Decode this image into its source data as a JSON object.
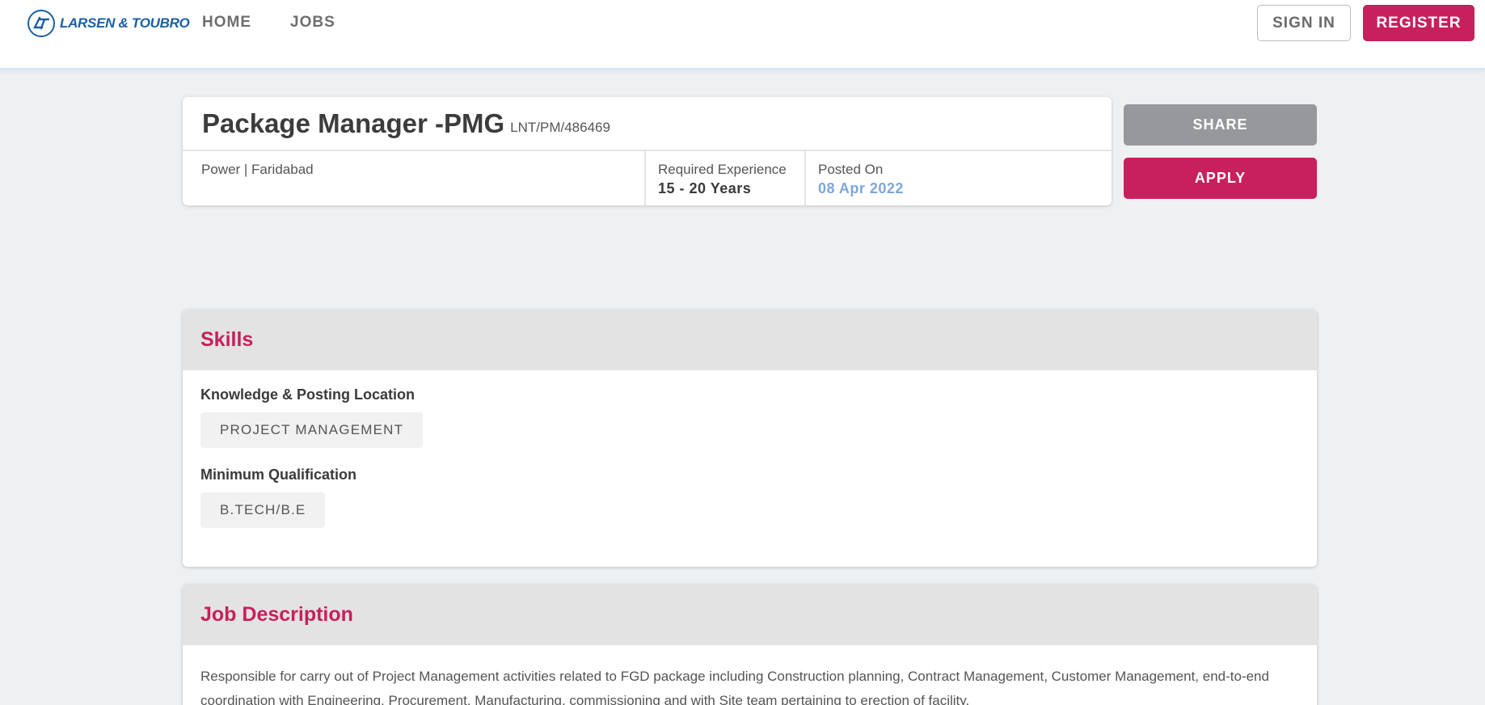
{
  "header": {
    "logo_text": "LARSEN & TOUBRO",
    "nav": [
      "HOME",
      "JOBS"
    ],
    "signin_label": "SIGN IN",
    "register_label": "REGISTER"
  },
  "job": {
    "title": "Package Manager -PMG",
    "code": "LNT/PM/486469",
    "location": "Power | Faridabad",
    "experience_label": "Required Experience",
    "experience_value": "15 - 20 Years",
    "posted_label": "Posted On",
    "posted_value": "08 Apr 2022"
  },
  "actions": {
    "share_label": "SHARE",
    "apply_label": "APPLY"
  },
  "skills": {
    "title": "Skills",
    "groups": [
      {
        "label": "Knowledge & Posting Location",
        "tag": "PROJECT MANAGEMENT"
      },
      {
        "label": "Minimum Qualification",
        "tag": "B.TECH/B.E"
      }
    ]
  },
  "description": {
    "title": "Job Description",
    "text": "Responsible for carry out of Project Management activities related to FGD package including Construction planning, Contract Management, Customer Management, end-to-end coordination with Engineering, Procurement, Manufacturing, commissioning and with Site team pertaining to erection of facility."
  },
  "colors": {
    "brand_blue": "#1b5fa5",
    "accent": "#c8205c",
    "date_blue": "#7fa7d8"
  }
}
